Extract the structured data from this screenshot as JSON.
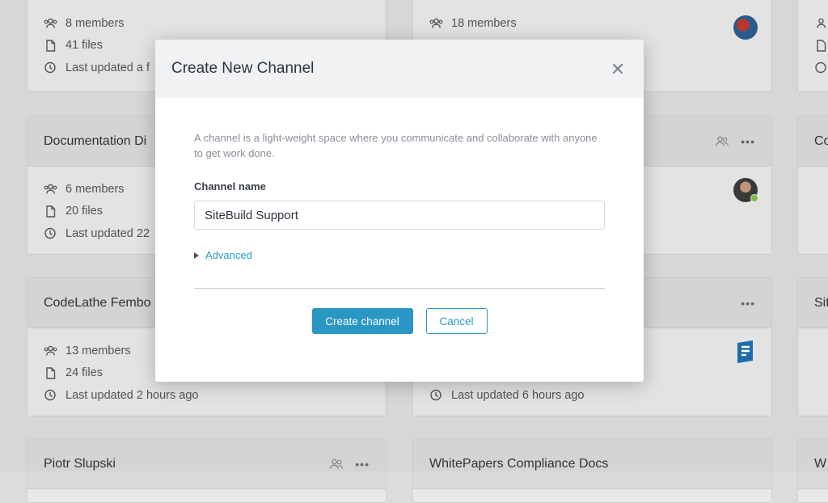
{
  "background_cards": [
    {
      "title": "",
      "members": "8 members",
      "files": "41 files",
      "updated": "Last updated a f"
    },
    {
      "title": "",
      "members": "18 members",
      "files": "",
      "updated": ""
    },
    {
      "title": "Documentation Di",
      "members": "6 members",
      "files": "20 files",
      "updated": "Last updated 22"
    },
    {
      "title": "CodeLathe Fembo",
      "members": "13 members",
      "files": "24 files",
      "updated": "Last updated 2 hours ago"
    },
    {
      "title": "",
      "members": "",
      "files": "",
      "updated": "Last updated 6 hours ago"
    },
    {
      "title": "Piotr Slupski",
      "members": "",
      "files": "",
      "updated": ""
    },
    {
      "title": "WhitePapers Compliance Docs",
      "members": "",
      "files": "",
      "updated": ""
    },
    {
      "title": "Co",
      "members": "",
      "files": "",
      "updated": ""
    },
    {
      "title": "Sit",
      "members": "",
      "files": "",
      "updated": ""
    },
    {
      "title": "W",
      "members": "",
      "files": "",
      "updated": ""
    }
  ],
  "modal": {
    "title": "Create New Channel",
    "description": "A channel is a light-weight space where you communicate and collaborate with anyone to get work done.",
    "channel_name_label": "Channel name",
    "channel_name_value": "SiteBuild Support",
    "advanced_label": "Advanced",
    "create_button": "Create channel",
    "cancel_button": "Cancel"
  },
  "colors": {
    "accent": "#2a96c4",
    "link": "#2a9bd1",
    "modal_header_bg": "#f1f2f4"
  }
}
